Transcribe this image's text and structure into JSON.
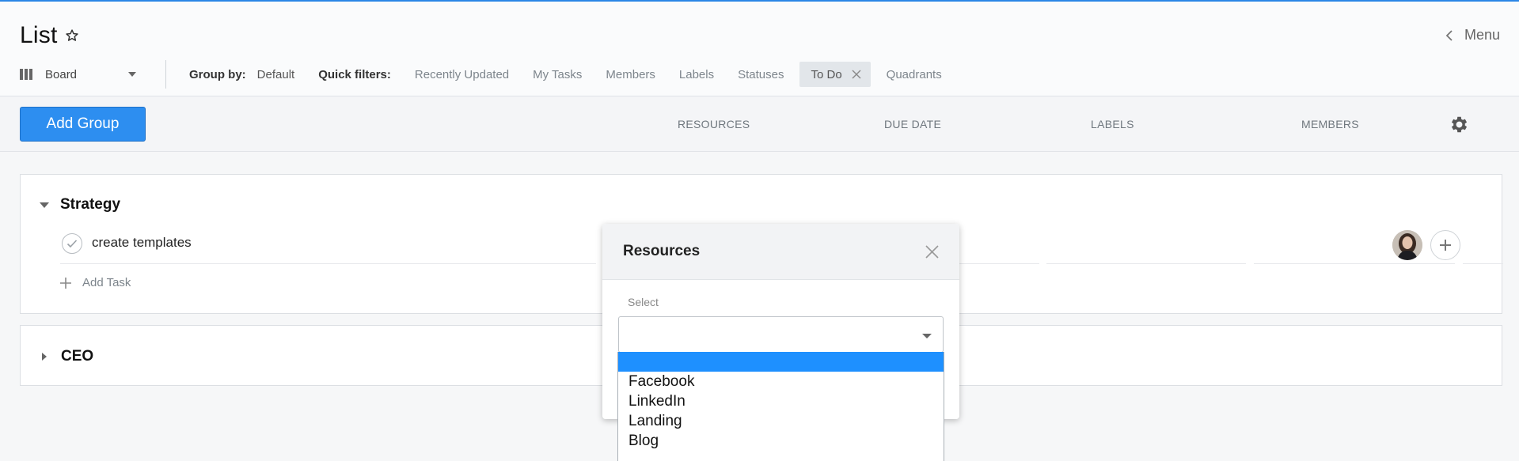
{
  "header": {
    "title": "List",
    "menu_label": "Menu"
  },
  "filters": {
    "view": "Board",
    "group_by_label": "Group by:",
    "group_by_value": "Default",
    "quick_filters_label": "Quick filters:",
    "items": [
      "Recently Updated",
      "My Tasks",
      "Members",
      "Labels",
      "Statuses"
    ],
    "active": "To Do",
    "after": "Quadrants"
  },
  "toolbar": {
    "add_group_label": "Add Group",
    "columns": [
      "RESOURCES",
      "DUE DATE",
      "LABELS",
      "MEMBERS"
    ]
  },
  "groups": [
    {
      "name": "Strategy",
      "expanded": true,
      "tasks": [
        {
          "name": "create templates",
          "partial_value": "5"
        }
      ],
      "add_task_label": "Add Task"
    },
    {
      "name": "CEO",
      "expanded": false
    }
  ],
  "modal": {
    "title": "Resources",
    "field_label": "Select",
    "selected": "",
    "options": [
      "",
      "Facebook",
      "LinkedIn",
      "Landing",
      "Blog"
    ]
  },
  "colors": {
    "accent": "#2d8ef0",
    "highlight": "#1e90ff",
    "top_line": "#2b86e6"
  }
}
